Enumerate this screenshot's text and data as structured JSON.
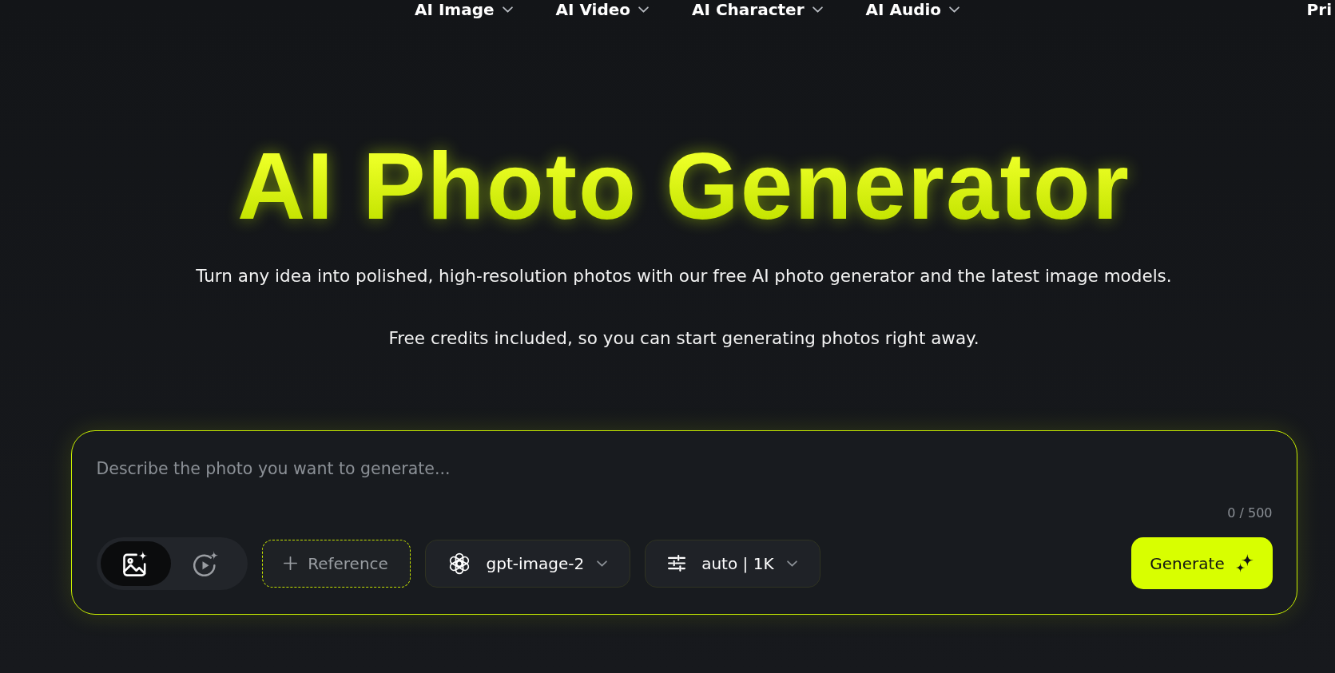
{
  "nav": {
    "items": [
      {
        "label": "AI Image",
        "kind": "dropdown"
      },
      {
        "label": "AI Video",
        "kind": "dropdown"
      },
      {
        "label": "AI Character",
        "kind": "dropdown"
      },
      {
        "label": "AI Audio",
        "kind": "dropdown"
      },
      {
        "label": "Pri",
        "kind": "link"
      }
    ]
  },
  "hero": {
    "title": "AI Photo Generator",
    "lines": [
      "Turn any idea into polished, high-resolution photos with our free AI photo generator and the latest image models.",
      "Free credits included, so you can start generating photos right away."
    ]
  },
  "prompt": {
    "placeholder": "Describe the photo you want to generate...",
    "counter": "0 / 500",
    "modes": [
      {
        "kind": "image",
        "selected": true
      },
      {
        "kind": "video",
        "selected": false
      }
    ],
    "reference_button": "Reference",
    "model": "gpt-image-2",
    "settings": "auto | 1K",
    "generate_button": "Generate"
  }
}
